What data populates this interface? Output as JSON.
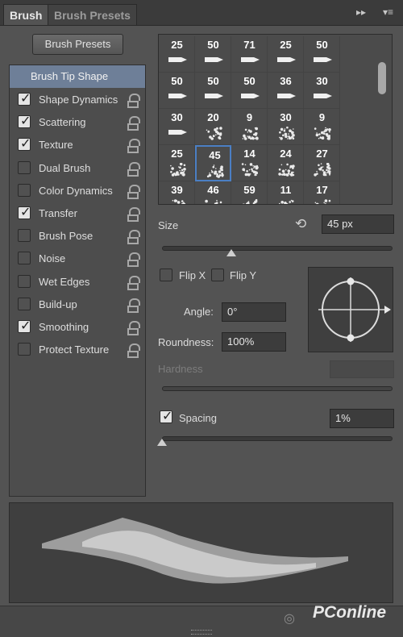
{
  "tabs": [
    {
      "label": "Brush"
    },
    {
      "label": "Brush Presets"
    }
  ],
  "preset_button": "Brush Presets",
  "left_list": {
    "header": "Brush Tip Shape",
    "items": [
      {
        "label": "Shape Dynamics",
        "checked": true
      },
      {
        "label": "Scattering",
        "checked": true
      },
      {
        "label": "Texture",
        "checked": true
      },
      {
        "label": "Dual Brush",
        "checked": false
      },
      {
        "label": "Color Dynamics",
        "checked": false
      },
      {
        "label": "Transfer",
        "checked": true
      },
      {
        "label": "Brush Pose",
        "checked": false
      },
      {
        "label": "Noise",
        "checked": false
      },
      {
        "label": "Wet Edges",
        "checked": false
      },
      {
        "label": "Build-up",
        "checked": false
      },
      {
        "label": "Smoothing",
        "checked": true
      },
      {
        "label": "Protect Texture",
        "checked": false
      }
    ]
  },
  "brush_sizes": [
    [
      "25",
      "50",
      "71",
      "25",
      "50"
    ],
    [
      "50",
      "50",
      "50",
      "36",
      "30"
    ],
    [
      "30",
      "20",
      "9",
      "30",
      "9"
    ],
    [
      "25",
      "45",
      "14",
      "24",
      "27"
    ],
    [
      "39",
      "46",
      "59",
      "11",
      "17"
    ]
  ],
  "selected_brush": "45",
  "size": {
    "label": "Size",
    "value": "45 px",
    "level": 0.3
  },
  "flip_x": "Flip X",
  "flip_y": "Flip Y",
  "angle": {
    "label": "Angle:",
    "value": "0°"
  },
  "roundness": {
    "label": "Roundness:",
    "value": "100%"
  },
  "hardness": {
    "label": "Hardness"
  },
  "spacing": {
    "label": "Spacing",
    "value": "1%",
    "checked": true,
    "level": 0.0
  },
  "watermark": "PConline"
}
